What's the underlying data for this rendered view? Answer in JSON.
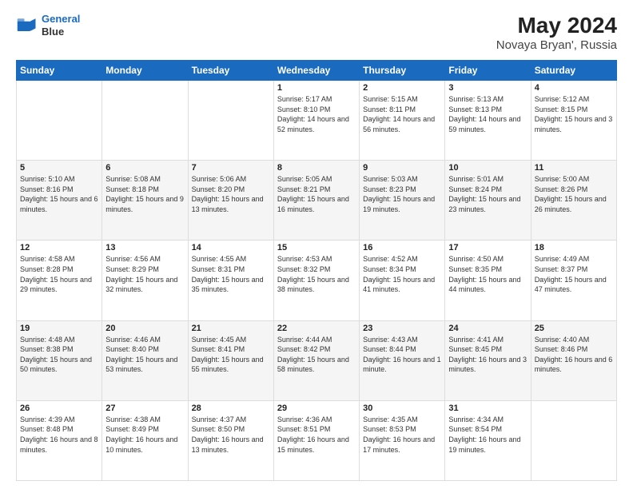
{
  "header": {
    "logo_line1": "General",
    "logo_line2": "Blue",
    "title": "May 2024",
    "subtitle": "Novaya Bryan', Russia"
  },
  "weekdays": [
    "Sunday",
    "Monday",
    "Tuesday",
    "Wednesday",
    "Thursday",
    "Friday",
    "Saturday"
  ],
  "weeks": [
    [
      {
        "day": "",
        "info": ""
      },
      {
        "day": "",
        "info": ""
      },
      {
        "day": "",
        "info": ""
      },
      {
        "day": "1",
        "info": "Sunrise: 5:17 AM\nSunset: 8:10 PM\nDaylight: 14 hours and 52 minutes."
      },
      {
        "day": "2",
        "info": "Sunrise: 5:15 AM\nSunset: 8:11 PM\nDaylight: 14 hours and 56 minutes."
      },
      {
        "day": "3",
        "info": "Sunrise: 5:13 AM\nSunset: 8:13 PM\nDaylight: 14 hours and 59 minutes."
      },
      {
        "day": "4",
        "info": "Sunrise: 5:12 AM\nSunset: 8:15 PM\nDaylight: 15 hours and 3 minutes."
      }
    ],
    [
      {
        "day": "5",
        "info": "Sunrise: 5:10 AM\nSunset: 8:16 PM\nDaylight: 15 hours and 6 minutes."
      },
      {
        "day": "6",
        "info": "Sunrise: 5:08 AM\nSunset: 8:18 PM\nDaylight: 15 hours and 9 minutes."
      },
      {
        "day": "7",
        "info": "Sunrise: 5:06 AM\nSunset: 8:20 PM\nDaylight: 15 hours and 13 minutes."
      },
      {
        "day": "8",
        "info": "Sunrise: 5:05 AM\nSunset: 8:21 PM\nDaylight: 15 hours and 16 minutes."
      },
      {
        "day": "9",
        "info": "Sunrise: 5:03 AM\nSunset: 8:23 PM\nDaylight: 15 hours and 19 minutes."
      },
      {
        "day": "10",
        "info": "Sunrise: 5:01 AM\nSunset: 8:24 PM\nDaylight: 15 hours and 23 minutes."
      },
      {
        "day": "11",
        "info": "Sunrise: 5:00 AM\nSunset: 8:26 PM\nDaylight: 15 hours and 26 minutes."
      }
    ],
    [
      {
        "day": "12",
        "info": "Sunrise: 4:58 AM\nSunset: 8:28 PM\nDaylight: 15 hours and 29 minutes."
      },
      {
        "day": "13",
        "info": "Sunrise: 4:56 AM\nSunset: 8:29 PM\nDaylight: 15 hours and 32 minutes."
      },
      {
        "day": "14",
        "info": "Sunrise: 4:55 AM\nSunset: 8:31 PM\nDaylight: 15 hours and 35 minutes."
      },
      {
        "day": "15",
        "info": "Sunrise: 4:53 AM\nSunset: 8:32 PM\nDaylight: 15 hours and 38 minutes."
      },
      {
        "day": "16",
        "info": "Sunrise: 4:52 AM\nSunset: 8:34 PM\nDaylight: 15 hours and 41 minutes."
      },
      {
        "day": "17",
        "info": "Sunrise: 4:50 AM\nSunset: 8:35 PM\nDaylight: 15 hours and 44 minutes."
      },
      {
        "day": "18",
        "info": "Sunrise: 4:49 AM\nSunset: 8:37 PM\nDaylight: 15 hours and 47 minutes."
      }
    ],
    [
      {
        "day": "19",
        "info": "Sunrise: 4:48 AM\nSunset: 8:38 PM\nDaylight: 15 hours and 50 minutes."
      },
      {
        "day": "20",
        "info": "Sunrise: 4:46 AM\nSunset: 8:40 PM\nDaylight: 15 hours and 53 minutes."
      },
      {
        "day": "21",
        "info": "Sunrise: 4:45 AM\nSunset: 8:41 PM\nDaylight: 15 hours and 55 minutes."
      },
      {
        "day": "22",
        "info": "Sunrise: 4:44 AM\nSunset: 8:42 PM\nDaylight: 15 hours and 58 minutes."
      },
      {
        "day": "23",
        "info": "Sunrise: 4:43 AM\nSunset: 8:44 PM\nDaylight: 16 hours and 1 minute."
      },
      {
        "day": "24",
        "info": "Sunrise: 4:41 AM\nSunset: 8:45 PM\nDaylight: 16 hours and 3 minutes."
      },
      {
        "day": "25",
        "info": "Sunrise: 4:40 AM\nSunset: 8:46 PM\nDaylight: 16 hours and 6 minutes."
      }
    ],
    [
      {
        "day": "26",
        "info": "Sunrise: 4:39 AM\nSunset: 8:48 PM\nDaylight: 16 hours and 8 minutes."
      },
      {
        "day": "27",
        "info": "Sunrise: 4:38 AM\nSunset: 8:49 PM\nDaylight: 16 hours and 10 minutes."
      },
      {
        "day": "28",
        "info": "Sunrise: 4:37 AM\nSunset: 8:50 PM\nDaylight: 16 hours and 13 minutes."
      },
      {
        "day": "29",
        "info": "Sunrise: 4:36 AM\nSunset: 8:51 PM\nDaylight: 16 hours and 15 minutes."
      },
      {
        "day": "30",
        "info": "Sunrise: 4:35 AM\nSunset: 8:53 PM\nDaylight: 16 hours and 17 minutes."
      },
      {
        "day": "31",
        "info": "Sunrise: 4:34 AM\nSunset: 8:54 PM\nDaylight: 16 hours and 19 minutes."
      },
      {
        "day": "",
        "info": ""
      }
    ]
  ]
}
